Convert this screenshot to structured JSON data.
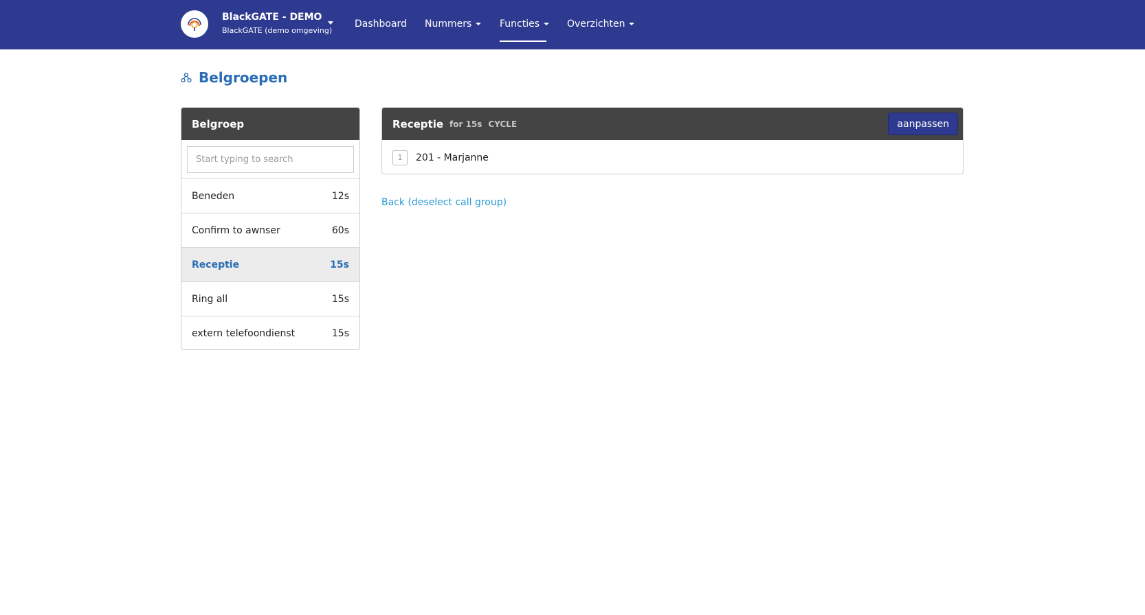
{
  "navbar": {
    "brand_title": "BlackGATE - DEMO",
    "brand_subtitle": "BlackGATE (demo omgeving)",
    "items": [
      {
        "label": "Dashboard"
      },
      {
        "label": "Nummers"
      },
      {
        "label": "Functies"
      },
      {
        "label": "Overzichten"
      }
    ],
    "active_item": "Functies",
    "background_color": "#2d3a8f"
  },
  "page": {
    "title": "Belgroepen",
    "title_icon": "sitemap-icon"
  },
  "left_panel": {
    "heading": "Belgroep",
    "search_placeholder": "Start typing to search",
    "groups": [
      {
        "name": "Beneden",
        "time": "12s"
      },
      {
        "name": "Confirm to awnser",
        "time": "60s"
      },
      {
        "name": "Receptie",
        "time": "15s",
        "selected": true
      },
      {
        "name": "Ring all",
        "time": "15s"
      },
      {
        "name": "extern telefoondienst",
        "time": "15s"
      }
    ]
  },
  "right_panel": {
    "title": "Receptie",
    "duration": "for 15s",
    "strategy": "CYCLE",
    "edit_label": "aanpassen",
    "members": [
      {
        "order": "1",
        "label": "201 - Marjanne"
      }
    ]
  },
  "back_link": "Back (deselect call group)"
}
